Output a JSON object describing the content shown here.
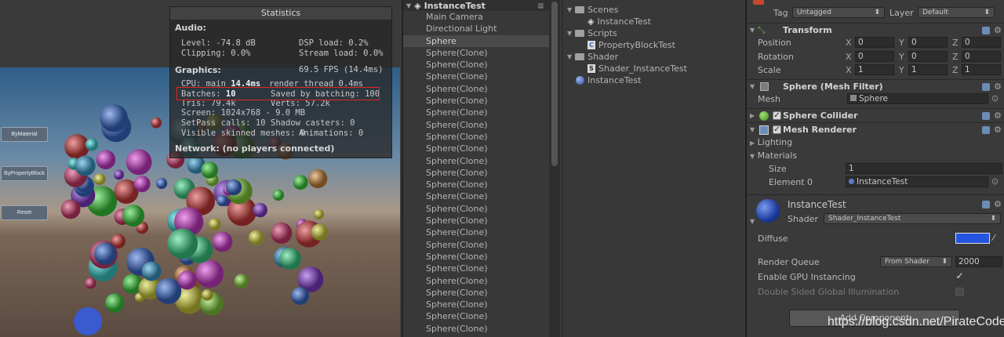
{
  "statistics": {
    "title": "Statistics",
    "audio_header": "Audio:",
    "level": "Level: -74.8 dB",
    "dsp_load": "DSP load: 0.2%",
    "clipping": "Clipping: 0.0%",
    "stream_load": "Stream load: 0.0%",
    "graphics_header": "Graphics:",
    "fps": "69.5 FPS (14.4ms)",
    "cpu_label": "CPU: main ",
    "cpu_value": "14.4ms",
    "render_thread": "render thread 0.4ms",
    "batches_label": "Batches: ",
    "batches_value": "10",
    "saved_by_batching": "Saved by batching: 100",
    "tris": "Tris: 79.4k",
    "verts": "Verts: 57.2k",
    "screen": "Screen: 1024x768 - 9.0 MB",
    "setpass": "SetPass calls: 10",
    "shadow_casters": "Shadow casters: 0",
    "skinned": "Visible skinned meshes: 0",
    "animations": "Animations: 0",
    "network": "Network: (no players connected)"
  },
  "game_buttons": [
    "ByMaterial",
    "ByPropertyBlock",
    "Reset"
  ],
  "hierarchy": {
    "scene": "InstanceTest",
    "items": [
      "Main Camera",
      "Directional Light",
      "Sphere",
      "Sphere(Clone)",
      "Sphere(Clone)",
      "Sphere(Clone)",
      "Sphere(Clone)",
      "Sphere(Clone)",
      "Sphere(Clone)",
      "Sphere(Clone)",
      "Sphere(Clone)",
      "Sphere(Clone)",
      "Sphere(Clone)",
      "Sphere(Clone)",
      "Sphere(Clone)",
      "Sphere(Clone)",
      "Sphere(Clone)",
      "Sphere(Clone)",
      "Sphere(Clone)",
      "Sphere(Clone)",
      "Sphere(Clone)",
      "Sphere(Clone)",
      "Sphere(Clone)",
      "Sphere(Clone)",
      "Sphere(Clone)",
      "Sphere(Clone)",
      "Sphere(Clone)"
    ],
    "selected_index": 2
  },
  "project": {
    "scenes_folder": "Scenes",
    "scene_file": "InstanceTest",
    "scripts_folder": "Scripts",
    "script_file": "PropertyBlockTest",
    "shader_folder": "Shader",
    "shader_file": "Shader_InstanceTest",
    "material_file": "InstanceTest"
  },
  "inspector": {
    "tag_label": "Tag",
    "tag_value": "Untagged",
    "layer_label": "Layer",
    "layer_value": "Default",
    "transform_title": "Transform",
    "position_label": "Position",
    "rotation_label": "Rotation",
    "scale_label": "Scale",
    "position": [
      "0",
      "0",
      "0"
    ],
    "rotation": [
      "0",
      "0",
      "0"
    ],
    "scale": [
      "1",
      "1",
      "1"
    ],
    "axes": [
      "X",
      "Y",
      "Z"
    ],
    "mesh_filter_title": "Sphere (Mesh Filter)",
    "mesh_label": "Mesh",
    "mesh_value": "Sphere",
    "sphere_collider_title": "Sphere Collider",
    "mesh_renderer_title": "Mesh Renderer",
    "lighting_label": "Lighting",
    "materials_label": "Materials",
    "size_label": "Size",
    "size_value": "1",
    "element0_label": "Element 0",
    "element0_value": "InstanceTest",
    "material_name": "InstanceTest",
    "shader_label": "Shader",
    "shader_value": "Shader_InstanceTest",
    "diffuse_label": "Diffuse",
    "diffuse_color": "#2454e0",
    "render_queue_label": "Render Queue",
    "render_queue_mode": "From Shader",
    "render_queue_value": "2000",
    "gpu_instancing_label": "Enable GPU Instancing",
    "double_sided_label": "Double Sided Global Illumination",
    "add_component": "Add Component"
  },
  "watermark": "https://blog.csdn.net/PirateCode"
}
